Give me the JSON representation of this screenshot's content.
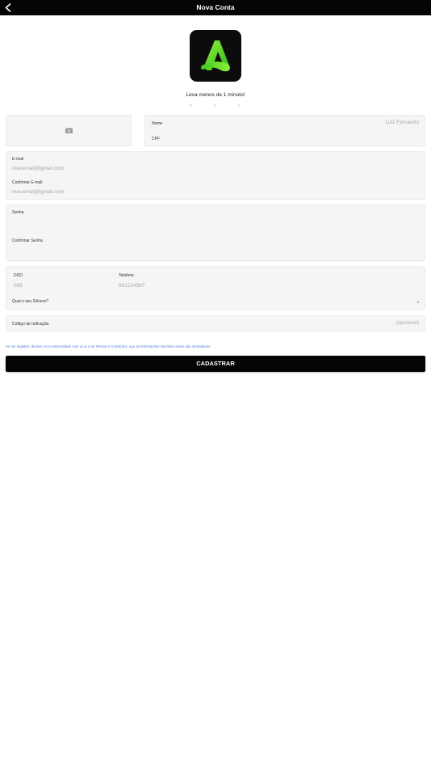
{
  "header": {
    "title": "Nova Conta",
    "back_icon": "chevron-left-icon"
  },
  "intro": {
    "tagline": "Leva menos de 1 minuto!",
    "step_count": 3,
    "logo_icon": "app-logo-icon",
    "accent_color": "#5fe02e"
  },
  "photo": {
    "icon": "camera-icon"
  },
  "identity": {
    "name_label": "Nome",
    "name_placeholder": "Luiz Fernando",
    "cpf_label": "CPF",
    "cpf_value": ""
  },
  "email": {
    "email_label": "E-mail",
    "email_placeholder": "meuemail@gmail.com",
    "confirm_label": "Confirmar E-mail",
    "confirm_placeholder": "meuemail@gmail.com"
  },
  "password": {
    "password_label": "Senha",
    "password_value": "",
    "confirm_label": "Confirmar Senha",
    "confirm_value": ""
  },
  "phone": {
    "ddd_label": "DDD",
    "ddd_placeholder": "099",
    "phone_label": "Telefone",
    "phone_placeholder": "991234567",
    "gender_label": "Qual o seu Gênero?",
    "gender_icon": "chevron-down-icon"
  },
  "referral": {
    "label": "Código de Indicação",
    "placeholder": "(opcional)"
  },
  "legal": {
    "text": "Ao me registrar, declaro, em conformidade com a Lei e os Termos e Condições, que as informações inseridas acima são verdadeiras."
  },
  "actions": {
    "submit_label": "CADASTRAR"
  }
}
